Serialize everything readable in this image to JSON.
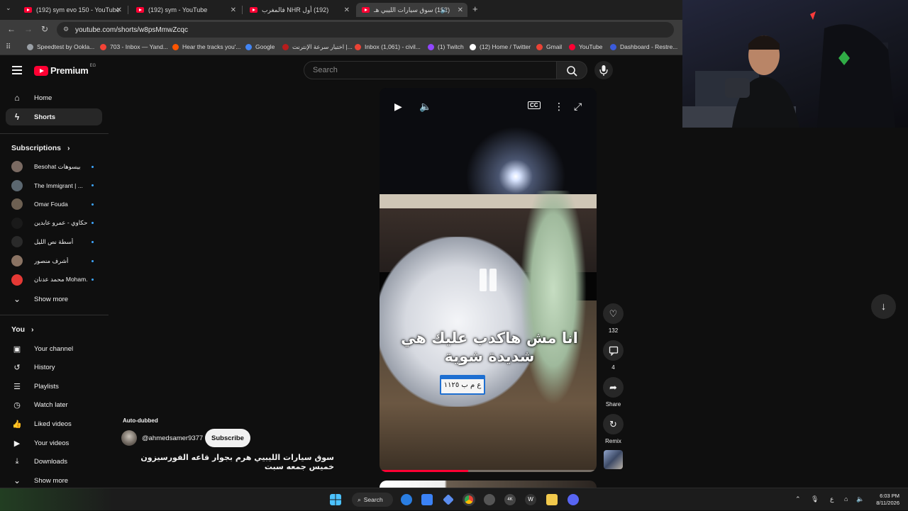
{
  "browser": {
    "tabs": [
      {
        "title": "(192) sym evo 150 - YouTube"
      },
      {
        "title": "(192) sym - YouTube"
      },
      {
        "title": "(192) أول NHR فالمغرب"
      },
      {
        "title": "(192) سوق سيارات الليبي هـ"
      }
    ],
    "url": "youtube.com/shorts/w8psMmwZcqc",
    "bookmarks": [
      {
        "label": "Speedtest by Ookla...",
        "color": "#9aa0a6"
      },
      {
        "label": "703 - Inbox — Yand...",
        "color": "#f44336"
      },
      {
        "label": "Hear the tracks you'...",
        "color": "#ff5500"
      },
      {
        "label": "Google",
        "color": "#4285f4"
      },
      {
        "label": "اختبار سرعة الإنترنت |...",
        "color": "#b71c1c"
      },
      {
        "label": "Inbox (1,061) - civil...",
        "color": "#ea4335"
      },
      {
        "label": "(1) Twitch",
        "color": "#9146ff"
      },
      {
        "label": "(12) Home / Twitter",
        "color": "#ffffff"
      },
      {
        "label": "Gmail",
        "color": "#ea4335"
      },
      {
        "label": "YouTube",
        "color": "#ff0033"
      },
      {
        "label": "Dashboard - Restre...",
        "color": "#3b5bdb"
      }
    ]
  },
  "header": {
    "logo_text": "Premium",
    "country_code": "EG",
    "search_placeholder": "Search"
  },
  "sidebar": {
    "main": [
      {
        "label": "Home",
        "icon": "home-icon"
      },
      {
        "label": "Shorts",
        "icon": "shorts-icon"
      }
    ],
    "subscriptions_heading": "Subscriptions",
    "subscriptions": [
      {
        "name": "Besohat بيسوهات",
        "color": "#7a6a62"
      },
      {
        "name": "The Immigrant | ...",
        "color": "#5b6770"
      },
      {
        "name": "Omar Fouda",
        "color": "#6d6052"
      },
      {
        "name": "حكاوي - عمرو عابدين",
        "color": "#1a1a1a"
      },
      {
        "name": "أسطة نص الليل",
        "color": "#2a2a2a"
      },
      {
        "name": "أشرف منصور",
        "color": "#8a7363"
      },
      {
        "name": "محمد عدنان Moham...",
        "color": "#e53935"
      }
    ],
    "show_more_1": "Show more",
    "you_heading": "You",
    "you_items": [
      {
        "label": "Your channel",
        "icon": "user-icon"
      },
      {
        "label": "History",
        "icon": "history-icon"
      },
      {
        "label": "Playlists",
        "icon": "playlist-icon"
      },
      {
        "label": "Watch later",
        "icon": "clock-icon"
      },
      {
        "label": "Liked videos",
        "icon": "thumbs-up-icon"
      },
      {
        "label": "Your videos",
        "icon": "video-icon"
      },
      {
        "label": "Downloads",
        "icon": "download-icon"
      }
    ],
    "show_more_2": "Show more"
  },
  "short": {
    "caption": "انا مش هاكدب عليك هي شديدة شوية",
    "plate": "ع م ب ١١٢٥",
    "progress": 0.41,
    "auto_dubbed": "Auto-dubbed",
    "channel": "@ahmedsamer9377",
    "subscribe_label": "Subscribe",
    "title": "سوق سيارات الليبيي هرم بجوار قاعه الفورسيزون خميس جمعه سبت"
  },
  "actions": {
    "likes": "132",
    "comments": "4",
    "share": "Share",
    "remix": "Remix"
  },
  "taskbar": {
    "search_label": "Search",
    "language": "ع",
    "time": "6:03 PM",
    "date": "8/11/2026"
  }
}
